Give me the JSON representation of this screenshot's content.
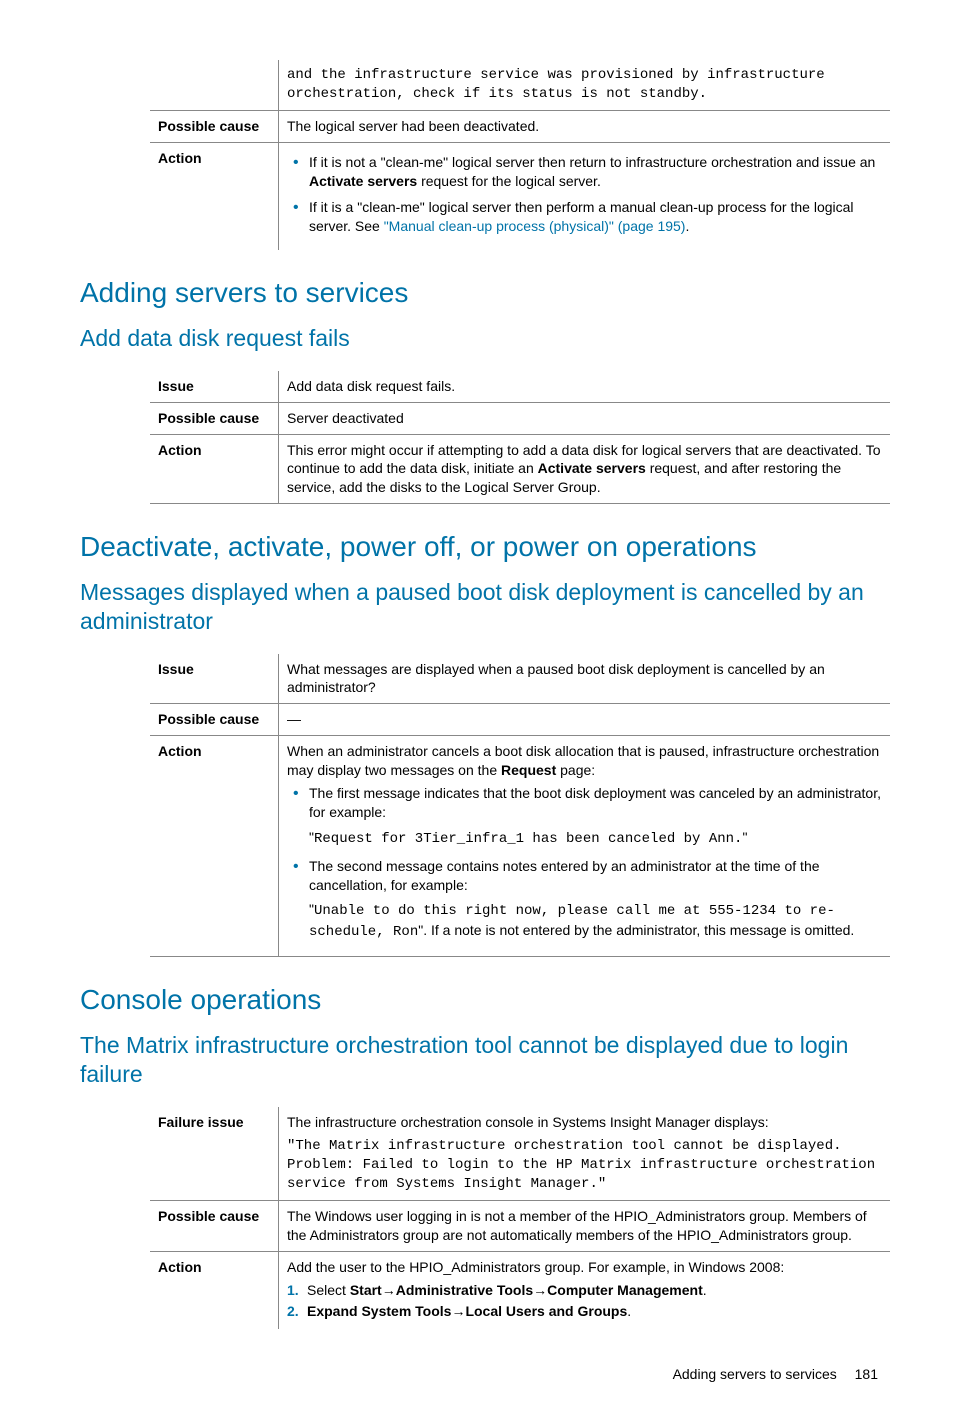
{
  "table0": {
    "row0_text": "and the infrastructure service was provisioned by infrastructure orchestration, check if its status is not standby.",
    "row1_label": "Possible cause",
    "row1_text": "The logical server had been deactivated.",
    "row2_label": "Action",
    "b1_pre": "If it is not a \"clean-me\" logical server then return to infrastructure orchestration and issue an ",
    "b1_bold": "Activate servers",
    "b1_post": " request for the logical server.",
    "b2_pre": "If it is a \"clean-me\" logical server then perform a manual clean-up process for the logical server. See ",
    "b2_link": "\"Manual clean-up process (physical)\" (page 195)",
    "b2_post": "."
  },
  "h1_1": "Adding servers to services",
  "h2_1": "Add data disk request fails",
  "table1": {
    "r0_label": "Issue",
    "r0_text": "Add data disk request fails.",
    "r1_label": "Possible cause",
    "r1_text": "Server deactivated",
    "r2_label": "Action",
    "r2_pre": "This error might occur if attempting to add a data disk for logical servers that are deactivated. To continue to add the data disk, initiate an ",
    "r2_bold": "Activate servers",
    "r2_post": " request, and after restoring the service, add the disks to the Logical Server Group."
  },
  "h1_2": "Deactivate, activate, power off, or power on operations",
  "h2_2": "Messages displayed when a paused boot disk deployment is cancelled by an administrator",
  "table2": {
    "r0_label": "Issue",
    "r0_text": "What messages are displayed when a paused boot disk deployment is cancelled by an administrator?",
    "r1_label": "Possible cause",
    "r1_text": "—",
    "r2_label": "Action",
    "intro_pre": "When an administrator cancels a boot disk allocation that is paused, infrastructure orchestration may display two messages on the ",
    "intro_bold": "Request",
    "intro_post": " page:",
    "b1": "The first message indicates that the boot disk deployment was canceled by an administrator, for example:",
    "code1_open": "\"",
    "code1": "Request for 3Tier_infra_1 has been canceled by Ann.",
    "code1_close": "\"",
    "b2": "The second message contains notes entered by an administrator at the time of the cancellation, for example:",
    "code2_open": "\"",
    "code2": "Unable to do this right now, please call me at 555-1234 to re-schedule, Ron",
    "code2_close": "\". If a note is not entered by the administrator, this message is omitted."
  },
  "h1_3": "Console operations",
  "h2_3": "The Matrix infrastructure orchestration tool cannot be displayed due to login failure",
  "table3": {
    "r0_label": "Failure issue",
    "r0_text": "The infrastructure orchestration console in Systems Insight Manager displays:",
    "r0_code": "\"The Matrix infrastructure orchestration tool cannot be displayed. Problem: Failed to login to the HP Matrix infrastructure orchestration service from Systems Insight Manager.\"",
    "r1_label": "Possible cause",
    "r1_text": "The Windows user logging in is not a member of the HPIO_Administrators group. Members of the Administrators group are not automatically members of the HPIO_Administrators group.",
    "r2_label": "Action",
    "r2_text": "Add the user to the HPIO_Administrators group. For example, in Windows 2008:",
    "s1_a": "Select ",
    "s1_b": "Start",
    "s1_c": "→",
    "s1_d": "Administrative Tools",
    "s1_e": "→",
    "s1_f": "Computer Management",
    "s1_g": ".",
    "s2_a": "Expand System Tools",
    "s2_b": "→",
    "s2_c": "Local Users and Groups",
    "s2_d": "."
  },
  "footer": {
    "title": "Adding servers to services",
    "page": "181"
  }
}
